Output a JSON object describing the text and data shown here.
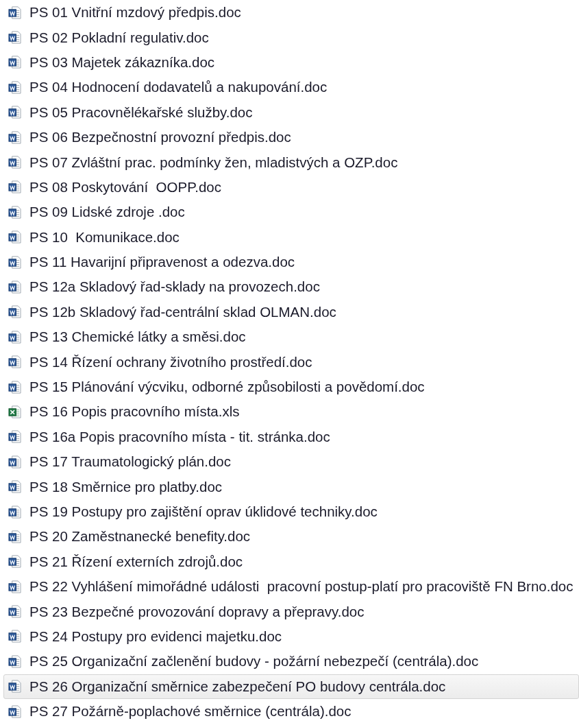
{
  "files": [
    {
      "name": "PS 01 Vnitřní mzdový předpis.doc",
      "kind": "word",
      "selected": false
    },
    {
      "name": "PS 02 Pokladní regulativ.doc",
      "kind": "word",
      "selected": false
    },
    {
      "name": "PS 03 Majetek zákazníka.doc",
      "kind": "word",
      "selected": false
    },
    {
      "name": "PS 04 Hodnocení dodavatelů a nakupování.doc",
      "kind": "word",
      "selected": false
    },
    {
      "name": "PS 05 Pracovnělékařské služby.doc",
      "kind": "word",
      "selected": false
    },
    {
      "name": "PS 06 Bezpečnostní provozní předpis.doc",
      "kind": "word",
      "selected": false
    },
    {
      "name": "PS 07 Zvláštní prac. podmínky žen, mladistvých a OZP.doc",
      "kind": "word",
      "selected": false
    },
    {
      "name": "PS 08 Poskytování  OOPP.doc",
      "kind": "word",
      "selected": false
    },
    {
      "name": "PS 09 Lidské zdroje .doc",
      "kind": "word",
      "selected": false
    },
    {
      "name": "PS 10  Komunikace.doc",
      "kind": "word",
      "selected": false
    },
    {
      "name": "PS 11 Havarijní připravenost a odezva.doc",
      "kind": "word",
      "selected": false
    },
    {
      "name": "PS 12a Skladový řad-sklady na provozech.doc",
      "kind": "word",
      "selected": false
    },
    {
      "name": "PS 12b Skladový řad-centrální sklad OLMAN.doc",
      "kind": "word",
      "selected": false
    },
    {
      "name": "PS 13 Chemické látky a směsi.doc",
      "kind": "word",
      "selected": false
    },
    {
      "name": "PS 14 Řízení ochrany životního prostředí.doc",
      "kind": "word",
      "selected": false
    },
    {
      "name": "PS 15 Plánování výcviku, odborné způsobilosti a povědomí.doc",
      "kind": "word",
      "selected": false
    },
    {
      "name": "PS 16 Popis pracovního místa.xls",
      "kind": "excel",
      "selected": false
    },
    {
      "name": "PS 16a Popis pracovního místa - tit. stránka.doc",
      "kind": "word",
      "selected": false
    },
    {
      "name": "PS 17 Traumatologický plán.doc",
      "kind": "word",
      "selected": false
    },
    {
      "name": "PS 18 Směrnice pro platby.doc",
      "kind": "word",
      "selected": false
    },
    {
      "name": "PS 19 Postupy pro zajištění oprav úklidové techniky.doc",
      "kind": "word",
      "selected": false
    },
    {
      "name": "PS 20 Zaměstnanecké benefity.doc",
      "kind": "word",
      "selected": false
    },
    {
      "name": "PS 21 Řízení externích zdrojů.doc",
      "kind": "word",
      "selected": false
    },
    {
      "name": "PS 22 Vyhlášení mimořádné události  pracovní postup-platí pro pracoviště FN Brno.doc",
      "kind": "word",
      "selected": false
    },
    {
      "name": "PS 23 Bezpečné provozování dopravy a přepravy.doc",
      "kind": "word",
      "selected": false
    },
    {
      "name": "PS 24 Postupy pro evidenci majetku.doc",
      "kind": "word",
      "selected": false
    },
    {
      "name": "PS 25 Organizační začlenění budovy - požární nebezpečí (centrála).doc",
      "kind": "word",
      "selected": false
    },
    {
      "name": "PS 26 Organizační směrnice zabezpečení PO budovy centrála.doc",
      "kind": "word",
      "selected": true
    },
    {
      "name": "PS 27 Požárně-poplachové směrnice (centrála).doc",
      "kind": "word",
      "selected": false
    }
  ]
}
